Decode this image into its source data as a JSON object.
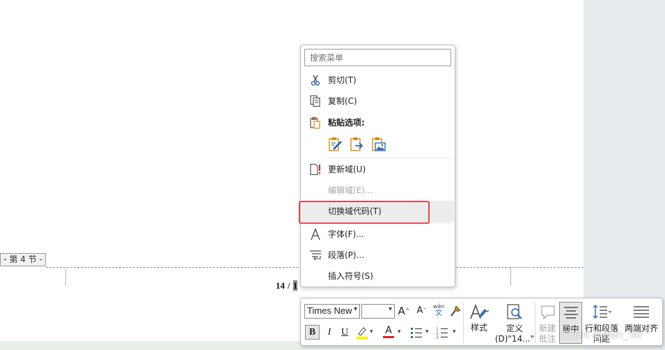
{
  "document": {
    "section_tag": "- 第 4 节 -",
    "page_current": "14",
    "page_separator": "/",
    "page_total": "1"
  },
  "context_menu": {
    "search_placeholder": "搜索菜单",
    "items": [
      {
        "label": "剪切(T)",
        "icon": "scissors-icon"
      },
      {
        "label": "复制(C)",
        "icon": "copy-icon"
      },
      {
        "label": "粘贴选项:",
        "icon": "paste-icon"
      },
      {
        "label": "更新域(U)",
        "icon": "update-field-icon"
      },
      {
        "label": "编辑域(E)...",
        "icon": "",
        "disabled": true
      },
      {
        "label": "切换域代码(T)",
        "icon": "",
        "highlighted": true
      },
      {
        "label": "字体(F)...",
        "icon": "font-icon"
      },
      {
        "label": "段落(P)...",
        "icon": "paragraph-icon"
      },
      {
        "label": "插入符号(S)",
        "icon": ""
      }
    ],
    "paste_options": [
      "keep-source-formatting-icon",
      "merge-formatting-icon",
      "picture-icon"
    ]
  },
  "mini_toolbar": {
    "font_name": "Times New",
    "font_size": "",
    "grow_font": "A",
    "shrink_font": "A",
    "phonetic_top": "wén",
    "phonetic_bottom": "文",
    "bold": "B",
    "italic": "I",
    "underline": "U",
    "font_color_letter": "A",
    "styles_label": "样式",
    "define_label_1": "定义",
    "define_label_2": "(D)\"14...\"",
    "new_comment_1": "新建",
    "new_comment_2": "批注",
    "center_label": "居中",
    "line_spacing_1": "行和段落",
    "line_spacing_2": "间距",
    "justify_label": "两端对齐"
  },
  "watermark": "CSDN @Wan_Yer",
  "colors": {
    "highlight_border": "#e8474e",
    "icon_blue": "#2b6cb0",
    "icon_orange": "#d98a1a",
    "highlight_yellow": "#ffee00",
    "font_red": "#e02020"
  }
}
